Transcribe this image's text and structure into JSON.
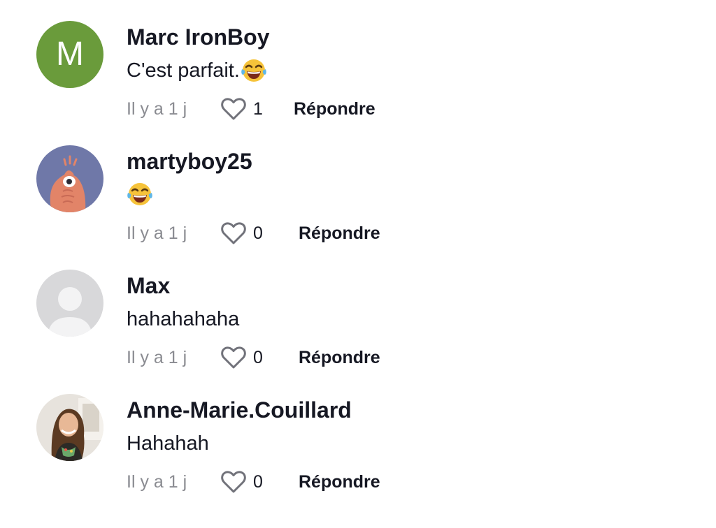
{
  "comments": [
    {
      "avatar_letter": "M",
      "username": "Marc IronBoy",
      "text": "C'est parfait.",
      "time": "Il y a 1 j",
      "likes": "1",
      "reply_label": "Répondre"
    },
    {
      "username": "martyboy25",
      "text": "",
      "time": "Il y a 1 j",
      "likes": "0",
      "reply_label": "Répondre"
    },
    {
      "username": "Max",
      "text": "hahahahaha",
      "time": "Il y a 1 j",
      "likes": "0",
      "reply_label": "Répondre"
    },
    {
      "username": "Anne-Marie.Couillard",
      "text": "Hahahah",
      "time": "Il y a 1 j",
      "likes": "0",
      "reply_label": "Répondre"
    }
  ],
  "icons": {
    "emoji": "face-with-tears-of-joy-emoji",
    "like": "heart-outline-icon"
  },
  "colors": {
    "avatar_green": "#6a9b3b",
    "avatar_purple": "#6f78a8",
    "text": "#161823",
    "muted": "#8a8b91"
  }
}
